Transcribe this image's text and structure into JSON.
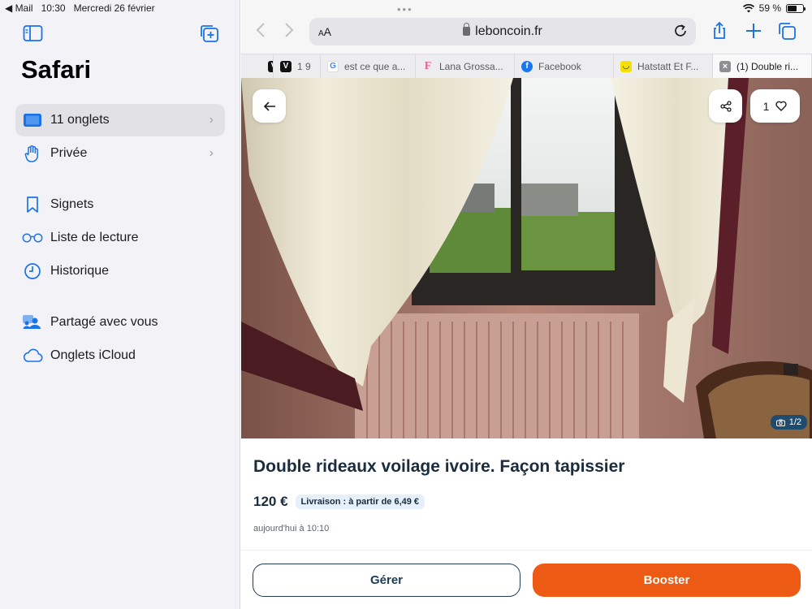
{
  "status": {
    "back_app": "◀ Mail",
    "time": "10:30",
    "date": "Mercredi 26 février",
    "battery": "59 %",
    "battery_level": 0.59
  },
  "sidebar": {
    "title": "Safari",
    "items": [
      {
        "label": "11 onglets",
        "icon": "tabs-icon",
        "chevron": true,
        "selected": true
      },
      {
        "label": "Privée",
        "icon": "hand-icon",
        "chevron": true
      },
      {
        "label": "Signets",
        "icon": "bookmark-icon"
      },
      {
        "label": "Liste de lecture",
        "icon": "glasses-icon"
      },
      {
        "label": "Historique",
        "icon": "clock-icon"
      },
      {
        "label": "Partagé avec vous",
        "icon": "shared-people-icon"
      },
      {
        "label": "Onglets iCloud",
        "icon": "cloud-icon"
      }
    ]
  },
  "browser": {
    "text_size": "AA",
    "domain": "leboncoin.fr",
    "tabs": [
      {
        "label": "",
        "favicon": "V"
      },
      {
        "label": "1 9",
        "favicon": "V"
      },
      {
        "label": "est ce que a...",
        "favicon": "G"
      },
      {
        "label": "Lana Grossa...",
        "favicon": "F"
      },
      {
        "label": "Facebook",
        "favicon": "f"
      },
      {
        "label": "Hatstatt Et F...",
        "favicon": "◡"
      },
      {
        "label": "(1) Double ri...",
        "favicon": "×",
        "active": true
      }
    ]
  },
  "listing": {
    "likes": "1",
    "photo_counter": "1/2",
    "title": "Double rideaux voilage ivoire. Façon tapissier",
    "price": "120 €",
    "delivery": "Livraison : à partir de 6,49 €",
    "date": "aujourd'hui à 10:10",
    "manage_label": "Gérer",
    "boost_label": "Booster"
  },
  "colors": {
    "accent": "#1a73e8",
    "boost": "#ec5a13",
    "navy": "#1a2c3d"
  }
}
